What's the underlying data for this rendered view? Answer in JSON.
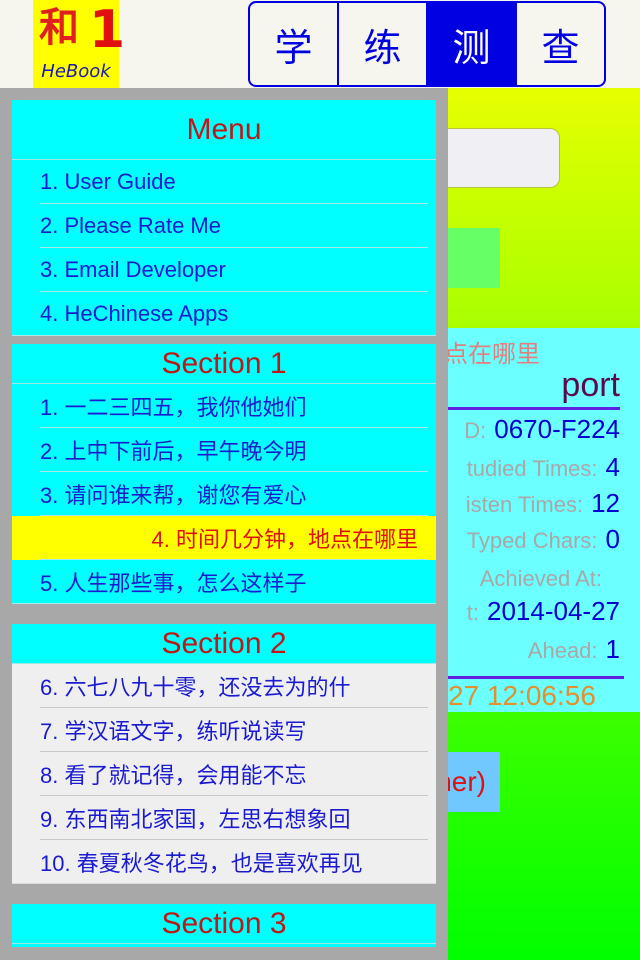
{
  "header": {
    "logo": {
      "char": "和",
      "number": "1",
      "text": "HeBook"
    },
    "tabs": [
      {
        "label": "学",
        "active": false
      },
      {
        "label": "练",
        "active": false
      },
      {
        "label": "测",
        "active": true
      },
      {
        "label": "查",
        "active": false
      }
    ]
  },
  "menu": {
    "title": "Menu",
    "items": [
      "1. User Guide",
      "2. Please Rate Me",
      "3. Email Developer",
      "4. HeChinese Apps"
    ]
  },
  "sections": [
    {
      "title": "Section 1",
      "items": [
        "1. 一二三四五，我你他她们",
        "2. 上中下前后，早午晚今明",
        "3. 请问谁来帮，谢您有爱心",
        "4. 时间几分钟，地点在哪里",
        "5. 人生那些事，怎么这样子"
      ],
      "selected_index": 3
    },
    {
      "title": "Section 2",
      "items": [
        "6. 六七八九十零，还没去为的什",
        "7. 学汉语文字，练听说读写",
        "8. 看了就记得，会用能不忘",
        "9. 东西南北家国，左思右想象回",
        "10. 春夏秋冬花鸟，也是喜欢再见"
      ]
    },
    {
      "title": "Section 3",
      "items": []
    }
  ],
  "background_report": {
    "lesson_partial": "点在哪里",
    "title_partial": "port",
    "id_label_partial": "D:",
    "id_value": "0670-F224",
    "studied_label_partial": "tudied Times:",
    "studied_value": "4",
    "listen_label_partial": "isten Times:",
    "listen_value": "12",
    "typed_label_partial": "Typed Chars:",
    "typed_value": "0",
    "achieved_label": "Achieved At:",
    "date_label_partial": "t:",
    "date_value": "2014-04-27",
    "ahead_label": "Ahead:",
    "ahead_value": "1",
    "timestamp_partial": "27 12:06:56",
    "button_partial": "ner)"
  }
}
